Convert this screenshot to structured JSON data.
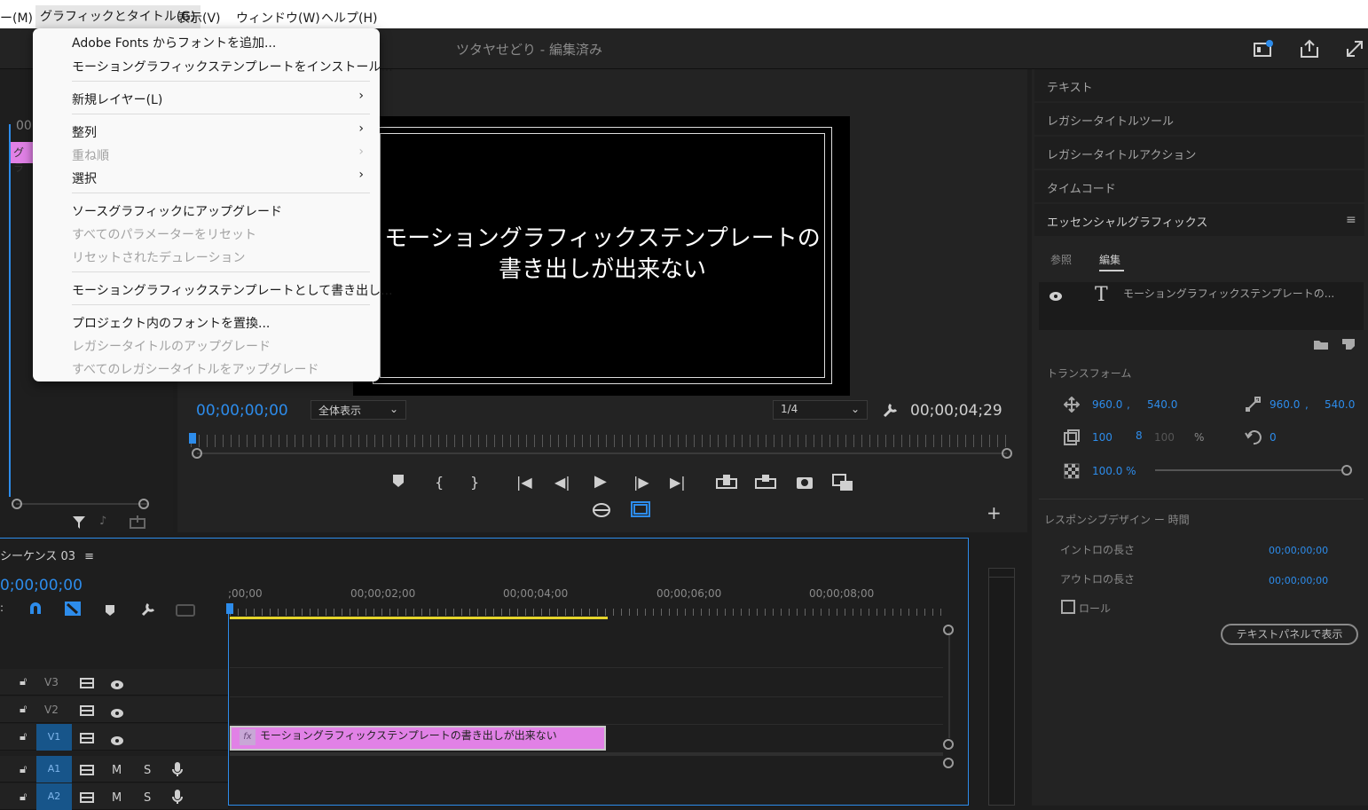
{
  "menubar": {
    "items": [
      "ー(M)",
      "グラフィックとタイトル(G)",
      "表示(V)",
      "ウィンドウ(W)",
      "ヘルプ(H)"
    ]
  },
  "titlebar": {
    "project_title": "ツタヤせどり - 編集済み"
  },
  "dropdown": {
    "items": [
      {
        "label": "Adobe Fonts からフォントを追加...",
        "disabled": false
      },
      {
        "label": "モーショングラフィックステンプレートをインストール...",
        "disabled": false
      },
      {
        "label": "新規レイヤー(L)",
        "disabled": false,
        "submenu": true
      },
      {
        "label": "整列",
        "disabled": false,
        "submenu": true
      },
      {
        "label": "重ね順",
        "disabled": true,
        "submenu": true
      },
      {
        "label": "選択",
        "disabled": false,
        "submenu": true
      },
      {
        "label": "ソースグラフィックにアップグレード",
        "disabled": false
      },
      {
        "label": "すべてのパラメーターをリセット",
        "disabled": true
      },
      {
        "label": "リセットされたデュレーション",
        "disabled": true
      },
      {
        "label": "モーショングラフィックステンプレートとして書き出し...",
        "disabled": false
      },
      {
        "label": "プロジェクト内のフォントを置換...",
        "disabled": false
      },
      {
        "label": "レガシータイトルのアップグレード",
        "disabled": true
      },
      {
        "label": "すべてのレガシータイトルをアップグレード",
        "disabled": true
      }
    ]
  },
  "left_panel": {
    "clip_label": "グラ",
    "tick_label": "00"
  },
  "program_monitor": {
    "overlay_line1": "モーショングラフィックステンプレートの",
    "overlay_line2": "書き出しが出来ない",
    "current_timecode": "00;00;00;00",
    "zoom_select": "全体表示",
    "quality_select": "1/4",
    "duration_timecode": "00;00;04;29"
  },
  "right_panel": {
    "sections": [
      "テキスト",
      "レガシータイトルツール",
      "レガシータイトルアクション",
      "タイムコード"
    ],
    "eg_title": "エッセンシャルグラフィックス",
    "tabs": [
      "参照",
      "編集"
    ],
    "active_tab": "編集",
    "layer_name": "モーショングラフィックステンプレートの...",
    "transform_label": "トランスフォーム",
    "position_x": "960.0",
    "position_y": "540.0",
    "anchor_x": "960.0",
    "anchor_y": "540.0",
    "scale": "100",
    "scale_linked": "100",
    "scale_unit": "%",
    "rotation": "0",
    "opacity": "100.0 %",
    "responsive_label": "レスポンシブデザイン ー 時間",
    "intro_label": "イントロの長さ",
    "intro_value": "00;00;00;00",
    "outro_label": "アウトロの長さ",
    "outro_value": "00;00;00;00",
    "roll_label": "ロール",
    "roll_checked": false,
    "text_panel_button": "テキストパネルで表示"
  },
  "timeline": {
    "sequence_name": "シーケンス 03",
    "timecode": "0;00;00;00",
    "ruler_labels": [
      ";00;00",
      "00;00;02;00",
      "00;00;04;00",
      "00;00;06;00",
      "00;00;08;00"
    ],
    "tracks": [
      {
        "name": "V3"
      },
      {
        "name": "V2"
      },
      {
        "name": "V1",
        "targeted": true
      },
      {
        "name": "A1",
        "targeted": true,
        "audio": true
      },
      {
        "name": "A2",
        "targeted": true,
        "audio": true
      }
    ],
    "mute_label": "M",
    "solo_label": "S",
    "clip_badge": "fx",
    "clip_name": "モーショングラフィックステンプレートの書き出しが出来ない"
  },
  "colors": {
    "accent_blue": "#2d8ceb",
    "clip_pink": "#e181e6",
    "work_area_yellow": "#e6d52b"
  }
}
